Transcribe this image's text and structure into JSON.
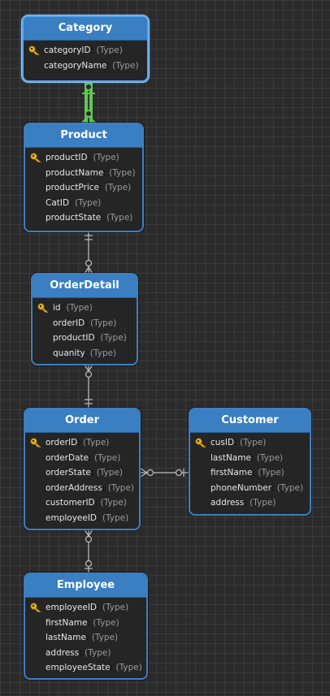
{
  "type_placeholder": "(Type)",
  "colors": {
    "header": "#3a7fc2",
    "border": "#3d7fc4",
    "connector": "#bdbdbd",
    "selected_connector": "#5cc94f",
    "key": "#e6b422"
  },
  "entities": {
    "category": {
      "name": "Category",
      "fields": [
        {
          "name": "categoryID",
          "pk": true
        },
        {
          "name": "categoryName",
          "pk": false
        }
      ]
    },
    "product": {
      "name": "Product",
      "fields": [
        {
          "name": "productID",
          "pk": true
        },
        {
          "name": "productName",
          "pk": false
        },
        {
          "name": "productPrice",
          "pk": false
        },
        {
          "name": "CatID",
          "pk": false
        },
        {
          "name": "productState",
          "pk": false
        }
      ]
    },
    "orderdetail": {
      "name": "OrderDetail",
      "fields": [
        {
          "name": "id",
          "pk": true
        },
        {
          "name": "orderID",
          "pk": false
        },
        {
          "name": "productID",
          "pk": false
        },
        {
          "name": "quanity",
          "pk": false
        }
      ]
    },
    "order": {
      "name": "Order",
      "fields": [
        {
          "name": "orderID",
          "pk": true
        },
        {
          "name": "orderDate",
          "pk": false
        },
        {
          "name": "orderState",
          "pk": false
        },
        {
          "name": "orderAddress",
          "pk": false
        },
        {
          "name": "customerID",
          "pk": false
        },
        {
          "name": "employeeID",
          "pk": false
        }
      ]
    },
    "customer": {
      "name": "Customer",
      "fields": [
        {
          "name": "cusID",
          "pk": true
        },
        {
          "name": "lastName",
          "pk": false
        },
        {
          "name": "firstName",
          "pk": false
        },
        {
          "name": "phoneNumber",
          "pk": false
        },
        {
          "name": "address",
          "pk": false
        }
      ]
    },
    "employee": {
      "name": "Employee",
      "fields": [
        {
          "name": "employeeID",
          "pk": true
        },
        {
          "name": "firstName",
          "pk": false
        },
        {
          "name": "lastName",
          "pk": false
        },
        {
          "name": "address",
          "pk": false
        },
        {
          "name": "employeeState",
          "pk": false
        }
      ]
    }
  },
  "relationships": [
    {
      "from": "category",
      "to": "product",
      "from_end": "one",
      "to_end": "many",
      "selected": true
    },
    {
      "from": "product",
      "to": "orderdetail",
      "from_end": "one",
      "to_end": "many",
      "selected": false
    },
    {
      "from": "orderdetail",
      "to": "order",
      "from_end": "many",
      "to_end": "one",
      "selected": false
    },
    {
      "from": "order",
      "to": "customer",
      "from_end": "many",
      "to_end": "one",
      "selected": false
    },
    {
      "from": "order",
      "to": "employee",
      "from_end": "many",
      "to_end": "one",
      "selected": false
    }
  ]
}
